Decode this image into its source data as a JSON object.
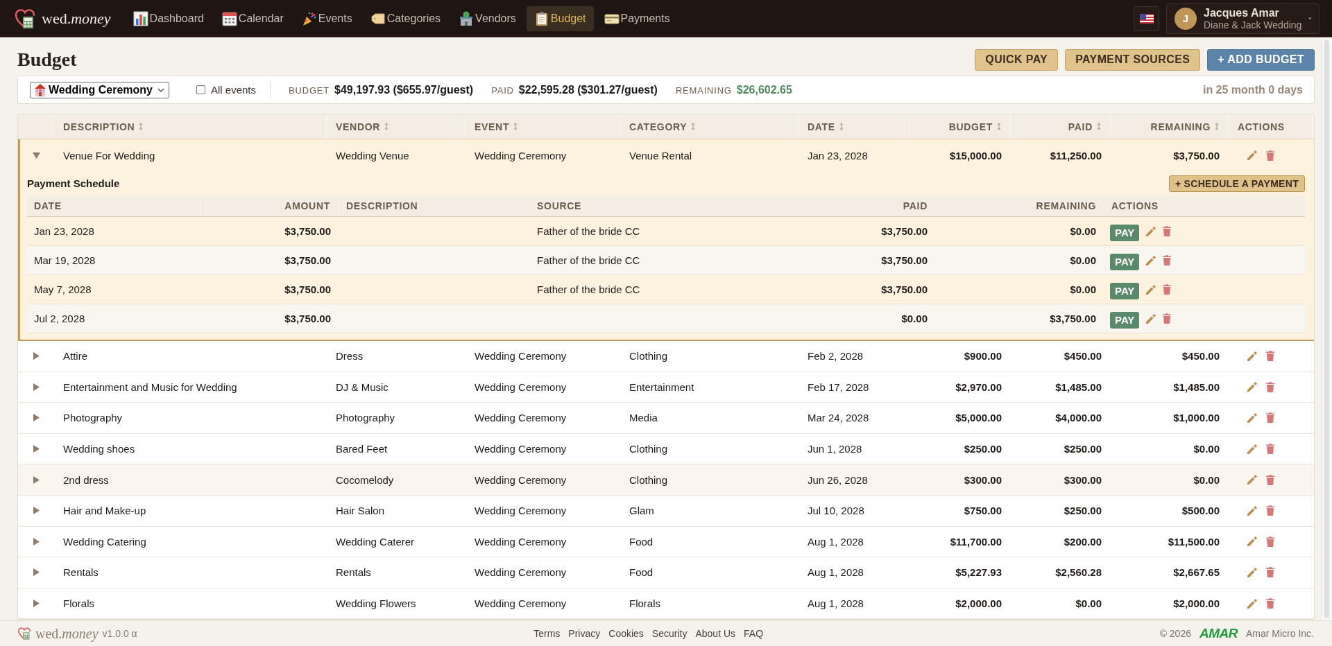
{
  "nav": {
    "brand": "wed.*money*",
    "items": [
      {
        "label": "Dashboard",
        "selected": false
      },
      {
        "label": "Calendar",
        "selected": false
      },
      {
        "label": "Events",
        "selected": false
      },
      {
        "label": "Categories",
        "selected": false
      },
      {
        "label": "Vendors",
        "selected": false
      },
      {
        "label": "Budget",
        "selected": true
      },
      {
        "label": "Payments",
        "selected": false
      }
    ]
  },
  "user": {
    "initial": "J",
    "name": "Jacques Amar",
    "wedding": "Diane & Jack Wedding"
  },
  "page": {
    "title": "Budget",
    "buttons": [
      {
        "label": "QUICK PAY",
        "kind": "secondary"
      },
      {
        "label": "PAYMENT SOURCES",
        "kind": "secondary"
      },
      {
        "label": "+ ADD BUDGET",
        "kind": "primary"
      }
    ]
  },
  "filter": {
    "event": "Wedding Ceremony",
    "all_events": {
      "label": "All events",
      "checked": false
    },
    "stats": [
      {
        "label": "BUDGET",
        "value": "$49,197.93 ($655.97/guest)",
        "kind": "neutral"
      },
      {
        "label": "PAID",
        "value": "$22,595.28 ($301.27/guest)",
        "kind": "neutral"
      },
      {
        "label": "REMAINING",
        "value": "$26,602.65",
        "kind": "positive"
      }
    ],
    "countdown": "in 25 month 0 days"
  },
  "table": {
    "columns": [
      {
        "label": "DESCRIPTION",
        "sortable": true
      },
      {
        "label": "VENDOR",
        "sortable": true
      },
      {
        "label": "EVENT",
        "sortable": true
      },
      {
        "label": "CATEGORY",
        "sortable": true
      },
      {
        "label": "DATE",
        "sortable": true
      },
      {
        "label": "BUDGET",
        "sortable": true
      },
      {
        "label": "PAID",
        "sortable": true
      },
      {
        "label": "REMAINING",
        "sortable": true
      },
      {
        "label": "ACTIONS",
        "sortable": false
      }
    ],
    "rows": [
      {
        "expanded": true,
        "hovered": false,
        "description": "Venue For Wedding",
        "vendor": "Wedding Venue",
        "event": "Wedding Ceremony",
        "category": "Venue Rental",
        "date": "Jan 23, 2028",
        "budget": "$15,000.00",
        "paid": "$11,250.00",
        "remaining": "$3,750.00",
        "schedule": {
          "title": "Payment Schedule",
          "add_button": "+ SCHEDULE A PAYMENT",
          "columns": [
            "DATE",
            "AMOUNT",
            "DESCRIPTION",
            "SOURCE",
            "PAID",
            "REMAINING",
            "ACTIONS"
          ],
          "payments": [
            {
              "date": "Jan 23, 2028",
              "amount": "$3,750.00",
              "source": "Father of the bride CC",
              "paid": "$3,750.00",
              "remaining": "$0.00",
              "action": "PAY"
            },
            {
              "date": "Mar 19, 2028",
              "amount": "$3,750.00",
              "source": "Father of the bride CC",
              "paid": "$3,750.00",
              "remaining": "$0.00",
              "action": "PAY"
            },
            {
              "date": "May 7, 2028",
              "amount": "$3,750.00",
              "source": "Father of the bride CC",
              "paid": "$3,750.00",
              "remaining": "$0.00",
              "action": "PAY"
            },
            {
              "date": "Jul 2, 2028",
              "amount": "$3,750.00",
              "paid": "$0.00",
              "remaining": "$3,750.00",
              "action": "PAY"
            }
          ]
        }
      },
      {
        "expanded": false,
        "hovered": false,
        "description": "Attire",
        "vendor": "Dress",
        "event": "Wedding Ceremony",
        "category": "Clothing",
        "date": "Feb 2, 2028",
        "budget": "$900.00",
        "paid": "$450.00",
        "remaining": "$450.00"
      },
      {
        "expanded": false,
        "hovered": false,
        "description": "Entertainment and Music for Wedding",
        "vendor": "DJ & Music",
        "event": "Wedding Ceremony",
        "category": "Entertainment",
        "date": "Feb 17, 2028",
        "budget": "$2,970.00",
        "paid": "$1,485.00",
        "remaining": "$1,485.00"
      },
      {
        "expanded": false,
        "hovered": false,
        "description": "Photography",
        "vendor": "Photography",
        "event": "Wedding Ceremony",
        "category": "Media",
        "date": "Mar 24, 2028",
        "budget": "$5,000.00",
        "paid": "$4,000.00",
        "remaining": "$1,000.00"
      },
      {
        "expanded": false,
        "hovered": false,
        "description": "Wedding shoes",
        "vendor": "Bared Feet",
        "event": "Wedding Ceremony",
        "category": "Clothing",
        "date": "Jun 1, 2028",
        "budget": "$250.00",
        "paid": "$250.00",
        "remaining": "$0.00"
      },
      {
        "expanded": false,
        "hovered": true,
        "description": "2nd dress",
        "vendor": "Cocomelody",
        "event": "Wedding Ceremony",
        "category": "Clothing",
        "date": "Jun 26, 2028",
        "budget": "$300.00",
        "paid": "$300.00",
        "remaining": "$0.00"
      },
      {
        "expanded": false,
        "hovered": false,
        "description": "Hair and Make-up",
        "vendor": "Hair Salon",
        "event": "Wedding Ceremony",
        "category": "Glam",
        "date": "Jul 10, 2028",
        "budget": "$750.00",
        "paid": "$250.00",
        "remaining": "$500.00"
      },
      {
        "expanded": false,
        "hovered": false,
        "description": "Wedding Catering",
        "vendor": "Wedding Caterer",
        "event": "Wedding Ceremony",
        "category": "Food",
        "date": "Aug 1, 2028",
        "budget": "$11,700.00",
        "paid": "$200.00",
        "remaining": "$11,500.00"
      },
      {
        "expanded": false,
        "hovered": false,
        "description": "Rentals",
        "vendor": "Rentals",
        "event": "Wedding Ceremony",
        "category": "Food",
        "date": "Aug 1, 2028",
        "budget": "$5,227.93",
        "paid": "$2,560.28",
        "remaining": "$2,667.65"
      },
      {
        "expanded": false,
        "hovered": false,
        "description": "Florals",
        "vendor": "Wedding Flowers",
        "event": "Wedding Ceremony",
        "category": "Florals",
        "date": "Aug 1, 2028",
        "budget": "$2,000.00",
        "paid": "$0.00",
        "remaining": "$2,000.00"
      }
    ]
  },
  "footer": {
    "brand": "wed.*money*",
    "version": "v1.0.0 α",
    "links": [
      "Terms",
      "Privacy",
      "Cookies",
      "Security",
      "About Us",
      "FAQ"
    ],
    "copyright": "© 2026",
    "company_logo": "AMAR",
    "company": "Amar Micro Inc."
  }
}
